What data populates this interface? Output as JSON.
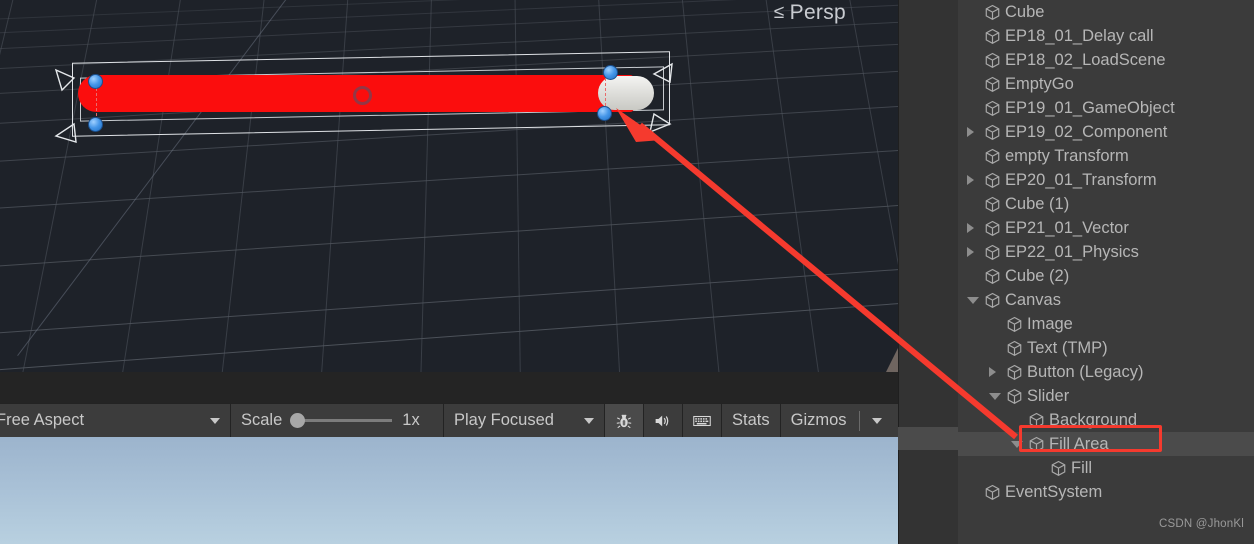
{
  "scene_view": {
    "camera_label": "Persp",
    "camera_arrow_glyph": "≤",
    "background_color": "#1e2229",
    "grid_color": "#51565e",
    "selected_object": "Fill Area",
    "gizmo": {
      "fill_color": "#fb0d0d",
      "handle_color": "#e8e8e4",
      "anchor_dot_color": "#4596e8",
      "outline_color": "#dfe2e6"
    }
  },
  "game_toolbar": {
    "aspect_label": "Free Aspect",
    "scale_label": "Scale",
    "scale_value": "1x",
    "play_mode_label": "Play Focused",
    "stats_label": "Stats",
    "gizmos_label": "Gizmos",
    "mute_icon": "speaker-icon",
    "debug_icon": "bug-icon",
    "keyboard_icon": "keyboard-icon",
    "kebab_icon": "more-options-icon"
  },
  "game_view": {
    "sky_top": "#9cb4cd",
    "sky_bottom": "#b8d0e0"
  },
  "hierarchy": {
    "panel_color": "#3b3b3b",
    "selection_color": "#4b4b4b",
    "annotation_color": "#f53a2e",
    "items": [
      {
        "label": "Cube",
        "indent": 1,
        "toggle": "none"
      },
      {
        "label": "EP18_01_Delay call",
        "indent": 1,
        "toggle": "none"
      },
      {
        "label": "EP18_02_LoadScene",
        "indent": 1,
        "toggle": "none"
      },
      {
        "label": "EmptyGo",
        "indent": 1,
        "toggle": "none"
      },
      {
        "label": "EP19_01_GameObject",
        "indent": 1,
        "toggle": "none"
      },
      {
        "label": "EP19_02_Component",
        "indent": 1,
        "toggle": "collapsed"
      },
      {
        "label": "empty Transform",
        "indent": 1,
        "toggle": "none"
      },
      {
        "label": "EP20_01_Transform",
        "indent": 1,
        "toggle": "collapsed"
      },
      {
        "label": "Cube (1)",
        "indent": 1,
        "toggle": "none"
      },
      {
        "label": "EP21_01_Vector",
        "indent": 1,
        "toggle": "collapsed"
      },
      {
        "label": "EP22_01_Physics",
        "indent": 1,
        "toggle": "collapsed"
      },
      {
        "label": "Cube (2)",
        "indent": 1,
        "toggle": "none"
      },
      {
        "label": "Canvas",
        "indent": 1,
        "toggle": "expanded"
      },
      {
        "label": "Image",
        "indent": 2,
        "toggle": "none"
      },
      {
        "label": "Text (TMP)",
        "indent": 2,
        "toggle": "none"
      },
      {
        "label": "Button (Legacy)",
        "indent": 2,
        "toggle": "collapsed"
      },
      {
        "label": "Slider",
        "indent": 2,
        "toggle": "expanded"
      },
      {
        "label": "Background",
        "indent": 3,
        "toggle": "none"
      },
      {
        "label": "Fill Area",
        "indent": 3,
        "toggle": "expanded",
        "selected": true
      },
      {
        "label": "Fill",
        "indent": 4,
        "toggle": "none"
      },
      {
        "label": "EventSystem",
        "indent": 1,
        "toggle": "none"
      }
    ]
  },
  "watermark": "CSDN @JhonKl"
}
